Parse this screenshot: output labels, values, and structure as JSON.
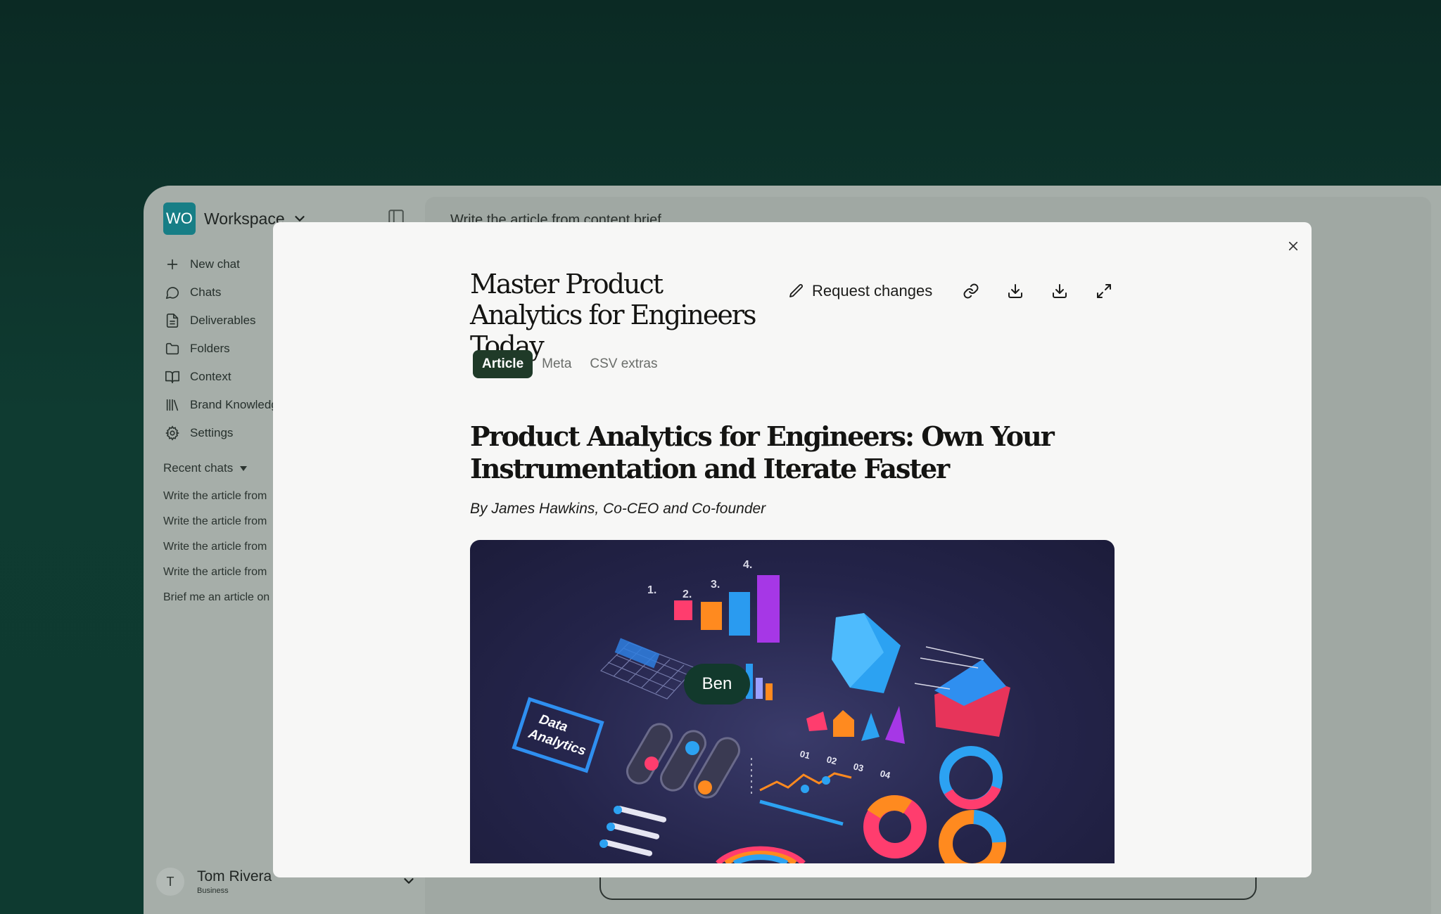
{
  "workspace": {
    "initials": "WO",
    "name": "Workspace"
  },
  "nav": [
    {
      "label": "New chat",
      "icon": "plus-icon"
    },
    {
      "label": "Chats",
      "icon": "chat-bubble-icon"
    },
    {
      "label": "Deliverables",
      "icon": "document-icon"
    },
    {
      "label": "Folders",
      "icon": "folder-icon"
    },
    {
      "label": "Context",
      "icon": "book-icon"
    },
    {
      "label": "Brand Knowledge",
      "icon": "library-icon"
    },
    {
      "label": "Settings",
      "icon": "gear-icon"
    }
  ],
  "recent": {
    "heading": "Recent chats",
    "items": [
      "Write the article from",
      "Write the article from",
      "Write the article from",
      "Write the article from",
      "Brief me an article on"
    ]
  },
  "user": {
    "initial": "T",
    "name": "Tom Rivera",
    "plan": "Business"
  },
  "main": {
    "chat_title": "Write the article from content brief"
  },
  "modal": {
    "title": "Master Product Analytics for Engineers Today",
    "request_changes": "Request changes",
    "tabs": [
      "Article",
      "Meta",
      "CSV extras"
    ],
    "active_tab": "Article",
    "article": {
      "heading": "Product Analytics for Engineers: Own Your Instrumentation and Iterate Faster",
      "byline": "By James Hawkins, Co-CEO and Co-founder",
      "hero_labels": {
        "steps": [
          "1.",
          "2.",
          "3.",
          "4."
        ],
        "sign_line1": "Data",
        "sign_line2": "Analytics",
        "numbers": [
          "01",
          "02",
          "03",
          "04"
        ],
        "cursor_name": "Ben"
      }
    }
  }
}
